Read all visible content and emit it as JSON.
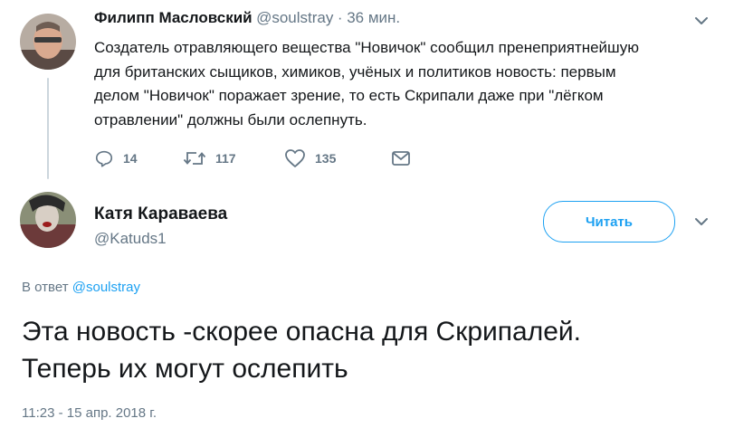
{
  "parent_tweet": {
    "name": "Филипп Масловский",
    "handle": "@soulstray",
    "time": "· 36 мин.",
    "text_lines": [
      "Создатель отравляющего вещества \"Новичок\" сообщил пренеприятнейшую",
      "для британских сыщиков, химиков, учёных и политиков новость: первым",
      "делом \"Новичок\" поражает зрение, то есть Скрипали даже при \"лёгком",
      "отравлении\" должны были ослепнуть."
    ],
    "actions": {
      "replies": "14",
      "retweets": "117",
      "likes": "135"
    }
  },
  "main_tweet": {
    "name": "Катя Караваева",
    "handle": "@Katuds1",
    "follow_label": "Читать",
    "reply_prefix": "В ответ",
    "reply_to": "@soulstray",
    "text_lines": [
      "Эта новость -скорее опасна для Скрипалей.",
      "Теперь их могут ослепить"
    ],
    "timestamp": "11:23 - 15 апр. 2018 г."
  },
  "colors": {
    "accent": "#1da1f2",
    "muted": "#657786",
    "text": "#14171a"
  },
  "icons": [
    "reply-icon",
    "retweet-icon",
    "like-icon",
    "dm-icon",
    "chevron-down-icon"
  ]
}
